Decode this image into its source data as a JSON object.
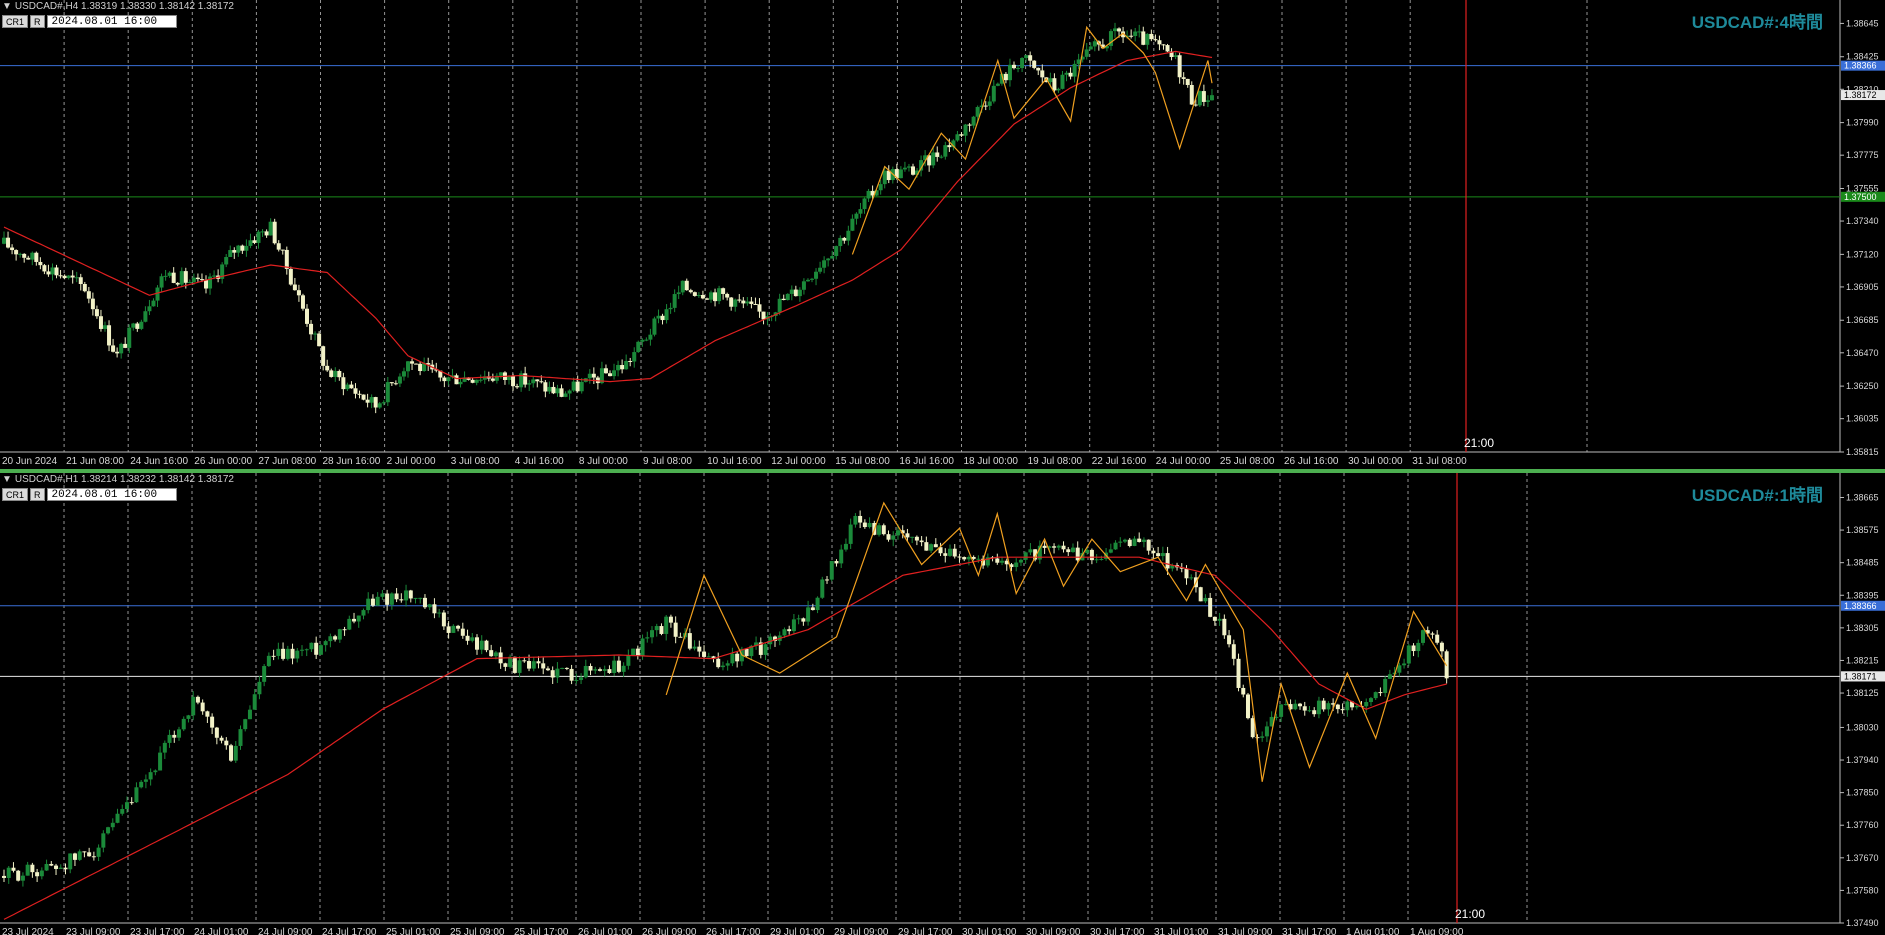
{
  "panels": [
    {
      "id": "h4",
      "header": "USDCAD#,H4  1.38319 1.38330 1.38142 1.38172",
      "buttons": [
        "CR1",
        "R"
      ],
      "datetime": "2024.08.01  16:00",
      "tf_label": "USDCAD#:4時間",
      "time_marker": "21:00"
    },
    {
      "id": "h1",
      "header": "USDCAD#,H1  1.38214 1.38232 1.38142 1.38172",
      "buttons": [
        "CR1",
        "R"
      ],
      "datetime": "2024.08.01  16:00",
      "tf_label": "USDCAD#:1時間",
      "time_marker": "21:00"
    }
  ],
  "colors": {
    "background": "#000000",
    "bull": "#1b8a3a",
    "bear": "#f2f2c8",
    "ma": "#e02020",
    "zigzag": "#f0a020",
    "blue_line": "#3a6fd8",
    "green_line": "#1a8a1a",
    "white_line": "#e8e8e8",
    "vline": "#e02020",
    "grid": "#bbbbbb",
    "tf_label": "#1e8a9a",
    "divider": "#4caf50"
  },
  "chart_data": [
    {
      "type": "candlestick",
      "title": "USDCAD#,H4",
      "ylim": [
        1.35815,
        1.3876
      ],
      "y_ticks": [
        "1.38645",
        "1.38425",
        "1.38210",
        "1.37990",
        "1.37775",
        "1.37555",
        "1.37340",
        "1.37120",
        "1.36905",
        "1.36685",
        "1.36470",
        "1.36250",
        "1.36035",
        "1.35815"
      ],
      "x_ticks": [
        "20 Jun 2024",
        "21 Jun 08:00",
        "24 Jun 16:00",
        "26 Jun 00:00",
        "27 Jun 08:00",
        "28 Jun 16:00",
        "2 Jul 00:00",
        "3 Jul 08:00",
        "4 Jul 16:00",
        "8 Jul 00:00",
        "9 Jul 08:00",
        "10 Jul 16:00",
        "12 Jul 00:00",
        "15 Jul 08:00",
        "16 Jul 16:00",
        "18 Jul 00:00",
        "19 Jul 08:00",
        "22 Jul 16:00",
        "24 Jul 00:00",
        "25 Jul 08:00",
        "26 Jul 16:00",
        "30 Jul 00:00",
        "31 Jul 08:00"
      ],
      "close_anchors": [
        [
          0,
          1.3719
        ],
        [
          10,
          1.3705
        ],
        [
          20,
          1.369
        ],
        [
          28,
          1.3645
        ],
        [
          40,
          1.37
        ],
        [
          50,
          1.369
        ],
        [
          57,
          1.3715
        ],
        [
          66,
          1.373
        ],
        [
          72,
          1.369
        ],
        [
          80,
          1.3635
        ],
        [
          92,
          1.3612
        ],
        [
          100,
          1.3642
        ],
        [
          108,
          1.363
        ],
        [
          120,
          1.3632
        ],
        [
          130,
          1.3628
        ],
        [
          138,
          1.362
        ],
        [
          148,
          1.3632
        ],
        [
          154,
          1.364
        ],
        [
          168,
          1.369
        ],
        [
          178,
          1.3685
        ],
        [
          188,
          1.3672
        ],
        [
          196,
          1.3688
        ],
        [
          208,
          1.3725
        ],
        [
          218,
          1.3765
        ],
        [
          226,
          1.3768
        ],
        [
          236,
          1.379
        ],
        [
          246,
          1.3825
        ],
        [
          252,
          1.3842
        ],
        [
          260,
          1.3822
        ],
        [
          270,
          1.3848
        ],
        [
          276,
          1.3858
        ],
        [
          284,
          1.3852
        ],
        [
          290,
          1.384
        ],
        [
          294,
          1.3815
        ],
        [
          299,
          1.3817
        ]
      ],
      "ma_anchors": [
        [
          0,
          1.373
        ],
        [
          20,
          1.3705
        ],
        [
          36,
          1.3685
        ],
        [
          50,
          1.3695
        ],
        [
          66,
          1.3705
        ],
        [
          80,
          1.37
        ],
        [
          92,
          1.367
        ],
        [
          100,
          1.3645
        ],
        [
          112,
          1.363
        ],
        [
          128,
          1.3632
        ],
        [
          150,
          1.3628
        ],
        [
          160,
          1.363
        ],
        [
          176,
          1.3655
        ],
        [
          196,
          1.3678
        ],
        [
          210,
          1.3695
        ],
        [
          222,
          1.3715
        ],
        [
          236,
          1.376
        ],
        [
          250,
          1.3798
        ],
        [
          264,
          1.3822
        ],
        [
          278,
          1.384
        ],
        [
          290,
          1.3846
        ],
        [
          299,
          1.3842
        ]
      ],
      "zigzag": [
        [
          210,
          1.3712
        ],
        [
          218,
          1.377
        ],
        [
          224,
          1.3755
        ],
        [
          232,
          1.3792
        ],
        [
          238,
          1.3775
        ],
        [
          246,
          1.384
        ],
        [
          250,
          1.3802
        ],
        [
          258,
          1.3828
        ],
        [
          264,
          1.38
        ],
        [
          268,
          1.3862
        ],
        [
          272,
          1.3848
        ],
        [
          277,
          1.3858
        ],
        [
          282,
          1.3845
        ],
        [
          285,
          1.3832
        ],
        [
          291,
          1.3782
        ],
        [
          298,
          1.384
        ],
        [
          299,
          1.3825
        ]
      ],
      "hlines": [
        {
          "price": 1.38366,
          "label": "1.38366",
          "color": "#3a6fd8"
        },
        {
          "price": 1.375,
          "label": "1.37500",
          "color": "#1a8a1a"
        }
      ],
      "last_price": {
        "price": 1.38172,
        "label": "1.38172"
      }
    },
    {
      "type": "candlestick",
      "title": "USDCAD#,H1",
      "ylim": [
        1.3749,
        1.38705
      ],
      "y_ticks": [
        "1.38665",
        "1.38575",
        "1.38485",
        "1.38395",
        "1.38305",
        "1.38215",
        "1.38125",
        "1.38030",
        "1.37940",
        "1.37850",
        "1.37760",
        "1.37670",
        "1.37580",
        "1.37490"
      ],
      "x_ticks": [
        "23 Jul 2024",
        "23 Jul 09:00",
        "23 Jul 17:00",
        "24 Jul 01:00",
        "24 Jul 09:00",
        "24 Jul 17:00",
        "25 Jul 01:00",
        "25 Jul 09:00",
        "25 Jul 17:00",
        "26 Jul 01:00",
        "26 Jul 09:00",
        "26 Jul 17:00",
        "29 Jul 01:00",
        "29 Jul 09:00",
        "29 Jul 17:00",
        "30 Jul 01:00",
        "30 Jul 09:00",
        "30 Jul 17:00",
        "31 Jul 01:00",
        "31 Jul 09:00",
        "31 Jul 17:00",
        "1 Aug 01:00",
        "1 Aug 09:00"
      ],
      "close_anchors": [
        [
          0,
          1.3762
        ],
        [
          12,
          1.3765
        ],
        [
          20,
          1.377
        ],
        [
          30,
          1.3788
        ],
        [
          40,
          1.381
        ],
        [
          48,
          1.3795
        ],
        [
          56,
          1.3822
        ],
        [
          66,
          1.3825
        ],
        [
          78,
          1.3838
        ],
        [
          85,
          1.384
        ],
        [
          95,
          1.383
        ],
        [
          108,
          1.382
        ],
        [
          120,
          1.3818
        ],
        [
          130,
          1.382
        ],
        [
          140,
          1.3832
        ],
        [
          150,
          1.382
        ],
        [
          160,
          1.3825
        ],
        [
          170,
          1.3835
        ],
        [
          180,
          1.386
        ],
        [
          190,
          1.3855
        ],
        [
          200,
          1.3852
        ],
        [
          210,
          1.3848
        ],
        [
          220,
          1.3852
        ],
        [
          230,
          1.385
        ],
        [
          240,
          1.3855
        ],
        [
          250,
          1.3845
        ],
        [
          258,
          1.383
        ],
        [
          264,
          1.38
        ],
        [
          272,
          1.381
        ],
        [
          280,
          1.3808
        ],
        [
          288,
          1.381
        ],
        [
          294,
          1.3818
        ],
        [
          300,
          1.383
        ],
        [
          304,
          1.3825
        ],
        [
          305,
          1.3817
        ]
      ],
      "ma_anchors": [
        [
          0,
          1.375
        ],
        [
          30,
          1.377
        ],
        [
          60,
          1.379
        ],
        [
          80,
          1.3808
        ],
        [
          100,
          1.3822
        ],
        [
          130,
          1.3823
        ],
        [
          150,
          1.3822
        ],
        [
          170,
          1.383
        ],
        [
          190,
          1.3845
        ],
        [
          210,
          1.385
        ],
        [
          240,
          1.385
        ],
        [
          256,
          1.3845
        ],
        [
          268,
          1.383
        ],
        [
          278,
          1.3815
        ],
        [
          288,
          1.3808
        ],
        [
          296,
          1.3812
        ],
        [
          305,
          1.3815
        ]
      ],
      "zigzag": [
        [
          140,
          1.3812
        ],
        [
          148,
          1.3845
        ],
        [
          156,
          1.3823
        ],
        [
          164,
          1.3818
        ],
        [
          176,
          1.3828
        ],
        [
          186,
          1.3865
        ],
        [
          194,
          1.3848
        ],
        [
          202,
          1.3858
        ],
        [
          206,
          1.3845
        ],
        [
          210,
          1.3862
        ],
        [
          214,
          1.384
        ],
        [
          220,
          1.3855
        ],
        [
          224,
          1.3842
        ],
        [
          230,
          1.3855
        ],
        [
          236,
          1.3846
        ],
        [
          244,
          1.385
        ],
        [
          250,
          1.3838
        ],
        [
          254,
          1.3848
        ],
        [
          262,
          1.383
        ],
        [
          266,
          1.3788
        ],
        [
          270,
          1.3815
        ],
        [
          276,
          1.3792
        ],
        [
          284,
          1.3818
        ],
        [
          290,
          1.38
        ],
        [
          298,
          1.3835
        ],
        [
          305,
          1.382
        ]
      ],
      "hlines": [
        {
          "price": 1.38366,
          "label": "1.38366",
          "color": "#3a6fd8"
        },
        {
          "price": 1.38171,
          "label": "1.38171",
          "color": "#e8e8e8"
        }
      ],
      "last_price": {
        "price": 1.38171,
        "label": "1.38171"
      }
    }
  ]
}
